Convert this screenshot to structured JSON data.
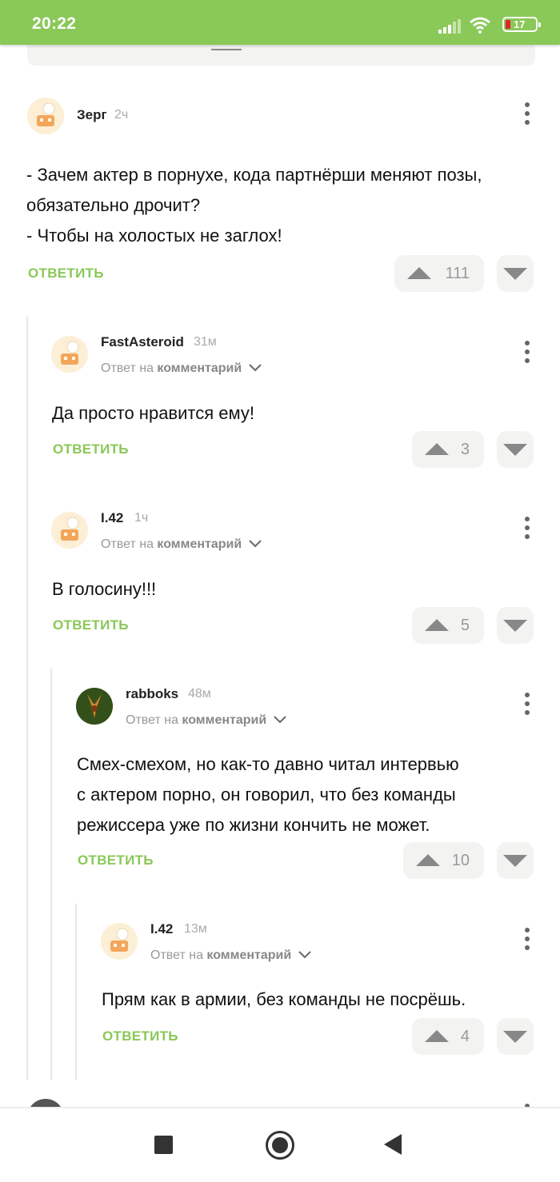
{
  "status": {
    "time": "20:22",
    "battery": "17"
  },
  "labels": {
    "reply": "ОТВЕТИТЬ",
    "reply_to_prefix": "Ответ на",
    "reply_to_target": "комментарий"
  },
  "comments": [
    {
      "user": "Зерг",
      "time": "2ч",
      "lines": [
        "- Зачем актер в порнухе, кода партнёрши меняют позы,",
        "обязательно дрочит?",
        "- Чтобы на холостых не заглох!"
      ],
      "votes": "111"
    },
    {
      "user": "FastAsteroid",
      "time": "31м",
      "lines": [
        "Да просто нравится ему!"
      ],
      "votes": "3"
    },
    {
      "user": "I.42",
      "time": "1ч",
      "lines": [
        "В голосину!!!"
      ],
      "votes": "5"
    },
    {
      "user": "rabboks",
      "time": "48м",
      "lines": [
        "Смех-смехом, но как-то давно читал интервью",
        "с актером порно, он говорил, что без команды",
        "режиссера уже по жизни кончить не может."
      ],
      "votes": "10"
    },
    {
      "user": "I.42",
      "time": "13м",
      "lines": [
        "Прям как в армии, без команды не посрёшь."
      ],
      "votes": "4"
    }
  ],
  "colors": {
    "accent": "#8ac858",
    "vote_bg": "#f3f4f2"
  },
  "icons": {
    "up": "triangle-up",
    "down": "triangle-down",
    "menu": "vertical-dots",
    "nav": [
      "square",
      "circle",
      "triangle-left"
    ]
  }
}
